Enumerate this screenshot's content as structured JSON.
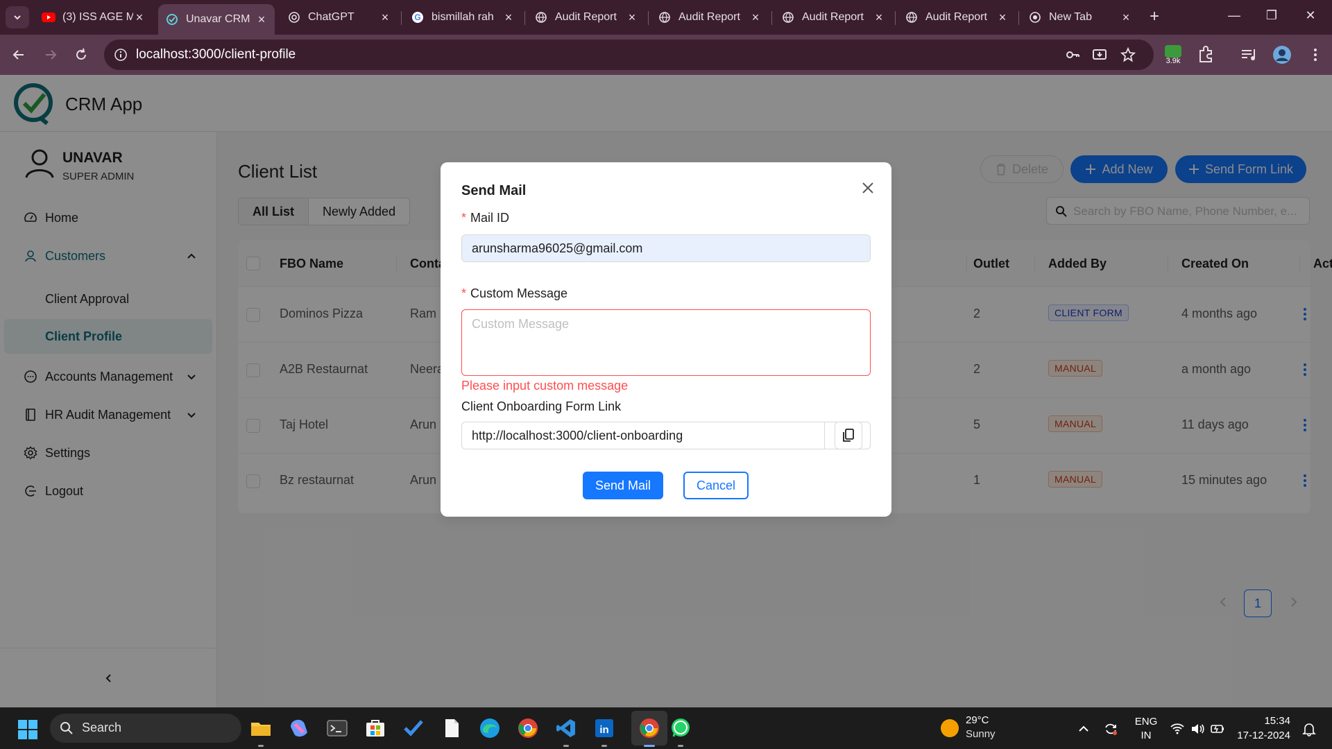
{
  "browser": {
    "tabs": [
      {
        "title": "(3) ISS AGE M",
        "icon": "youtube-icon"
      },
      {
        "title": "Unavar CRM",
        "icon": "crm-icon",
        "active": true
      },
      {
        "title": "ChatGPT",
        "icon": "chatgpt-icon"
      },
      {
        "title": "bismillah rah",
        "icon": "google-icon"
      },
      {
        "title": "Audit Report",
        "icon": "globe-icon"
      },
      {
        "title": "Audit Report",
        "icon": "globe-icon"
      },
      {
        "title": "Audit Report",
        "icon": "globe-icon"
      },
      {
        "title": "Audit Report",
        "icon": "globe-icon"
      },
      {
        "title": "New Tab",
        "icon": "chrome-icon"
      }
    ],
    "url": "localhost:3000/client-profile",
    "extension_badge": "3.9k"
  },
  "app": {
    "name": "CRM App",
    "brand_color": "#0f6f7d",
    "accent_color": "#1677ff"
  },
  "user": {
    "name": "UNAVAR",
    "role": "SUPER ADMIN"
  },
  "sidebar": {
    "items": [
      {
        "label": "Home",
        "icon": "dashboard-icon"
      },
      {
        "label": "Customers",
        "icon": "user-icon",
        "expanded": true
      },
      {
        "label": "Accounts Management",
        "icon": "chat-icon"
      },
      {
        "label": "HR Audit Management",
        "icon": "book-icon"
      },
      {
        "label": "Settings",
        "icon": "gear-icon"
      },
      {
        "label": "Logout",
        "icon": "logout-icon"
      }
    ],
    "subitems": [
      {
        "label": "Client Approval"
      },
      {
        "label": "Client Profile",
        "active": true
      }
    ]
  },
  "page": {
    "title": "Client List",
    "tabs": [
      "All List",
      "Newly Added"
    ],
    "active_tab": "All List",
    "delete_label": "Delete",
    "add_new_label": "Add New",
    "send_form_label": "Send Form Link",
    "search_placeholder": "Search by FBO Name, Phone Number, e..."
  },
  "table": {
    "columns": [
      "FBO Name",
      "Conta",
      "Outlet",
      "Added By",
      "Created On",
      "Action"
    ],
    "rows": [
      {
        "fbo": "Dominos Pizza",
        "contact": "Ram",
        "outlet": "2",
        "added_by": "CLIENT FORM",
        "created": "4 months ago"
      },
      {
        "fbo": "A2B Restaurnat",
        "contact": "Neera",
        "outlet": "2",
        "added_by": "MANUAL",
        "created": "a month ago"
      },
      {
        "fbo": "Taj Hotel",
        "contact": "Arun s",
        "outlet": "5",
        "added_by": "MANUAL",
        "created": "11 days ago"
      },
      {
        "fbo": "Bz restaurnat",
        "contact": "Arun S",
        "outlet": "1",
        "added_by": "MANUAL",
        "created": "15 minutes ago"
      }
    ]
  },
  "pagination": {
    "current": "1"
  },
  "modal": {
    "title": "Send Mail",
    "mail_label": "Mail ID",
    "mail_value": "arunsharma96025@gmail.com",
    "message_label": "Custom Message",
    "message_placeholder": "Custom Message",
    "message_error": "Please input custom message",
    "link_label": "Client Onboarding Form Link",
    "link_value": "http://localhost:3000/client-onboarding",
    "send_label": "Send Mail",
    "cancel_label": "Cancel"
  },
  "taskbar": {
    "search_label": "Search",
    "weather_temp": "29°C",
    "weather_desc": "Sunny",
    "lang_1": "ENG",
    "lang_2": "IN",
    "time": "15:34",
    "date": "17-12-2024"
  }
}
